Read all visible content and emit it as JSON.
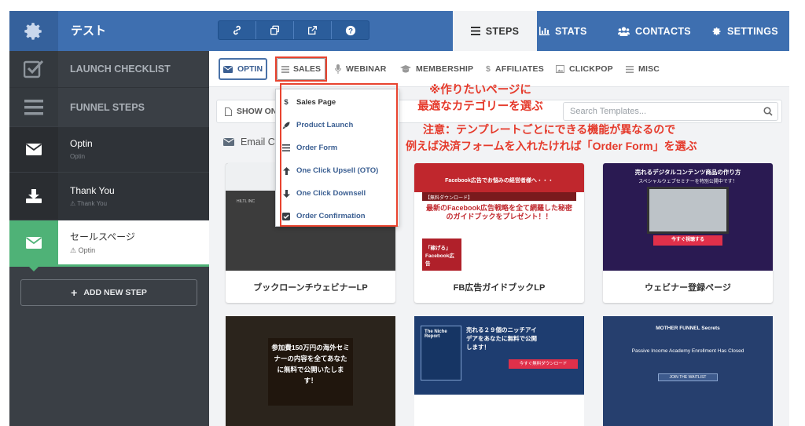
{
  "header": {
    "title": "テスト",
    "tabs": [
      {
        "label": "STEPS",
        "icon": "list-icon",
        "active": true
      },
      {
        "label": "STATS",
        "icon": "bar-chart-icon"
      },
      {
        "label": "CONTACTS",
        "icon": "users-icon"
      },
      {
        "label": "SETTINGS",
        "icon": "gear-icon"
      }
    ],
    "tool_icons": [
      "link-icon",
      "clone-icon",
      "external-link-icon",
      "help-icon"
    ]
  },
  "sidebar": {
    "launch_checklist": "LAUNCH CHECKLIST",
    "funnel_steps": "FUNNEL STEPS",
    "steps": [
      {
        "name": "Optin",
        "sub": "Optin"
      },
      {
        "name": "Thank You",
        "sub": "Thank You"
      },
      {
        "name": "セールスページ",
        "sub": "Optin"
      }
    ],
    "add_step": "ADD NEW STEP"
  },
  "categories": {
    "optin": "OPTIN",
    "sales": "SALES",
    "webinar": "WEBINAR",
    "membership": "MEMBERSHIP",
    "affiliates": "AFFILIATES",
    "clickpop": "CLICKPOP",
    "misc": "MISC"
  },
  "dropdown": {
    "items": [
      {
        "label": "Sales Page"
      },
      {
        "label": "Product Launch"
      },
      {
        "label": "Order Form"
      },
      {
        "label": "One Click Upsell (OTO)"
      },
      {
        "label": "One Click Downsell"
      },
      {
        "label": "Order Confirmation"
      }
    ]
  },
  "filter": {
    "show_label": "SHOW ON",
    "search_placeholder": "Search Templates..."
  },
  "section_label": "Email C",
  "annotations": {
    "line1": "※作りたいページに",
    "line2": "最適なカテゴリーを選ぶ",
    "line3": "注意：テンプレートごとにできる機能が異なるので",
    "line4": "例えば決済フォームを入れたければ「Order Form」を選ぶ"
  },
  "templates": [
    {
      "title": "ブックローンチウェビナーLP",
      "thumb_caption": "HILTL INC"
    },
    {
      "title": "FB広告ガイドブックLP",
      "thumb_head": "Facebook広告でお悩みの経営者様へ・・・",
      "thumb_badge": "【無料ダウンロード】",
      "thumb_main": "最新のFacebook広告戦略を全て網羅した秘密のガイドブックをプレゼント！！",
      "thumb_book": "「稼げる」Facebook広告"
    },
    {
      "title": "ウェビナー登録ページ",
      "thumb_head": "売れるデジタルコンテンツ商品の作り方",
      "thumb_sub": "スペシャルウェブセミナーを特別公開中です！",
      "thumb_btn": "今すぐ視聴する"
    },
    {
      "thumb_main": "参加費150万円の海外セミナーの内容を全てあなたに無料で公開いたします！"
    },
    {
      "thumb_book": "The Niche Report",
      "thumb_main": "売れる２９個のニッチアイデアをあなたに無料で公開します！",
      "thumb_btn": "今すぐ無料ダウンロード"
    },
    {
      "thumb_brand": "MOTHER FUNNEL Secrets",
      "thumb_main": "Passive Income Academy Enrollment Has Closed",
      "thumb_btn": "JOIN THE WAITLIST"
    }
  ],
  "colors": {
    "header_blue": "#3e6fb0",
    "sidebar_dark": "#3a3f45",
    "active_green": "#4fb277",
    "annotation_red": "#e53a2b"
  }
}
